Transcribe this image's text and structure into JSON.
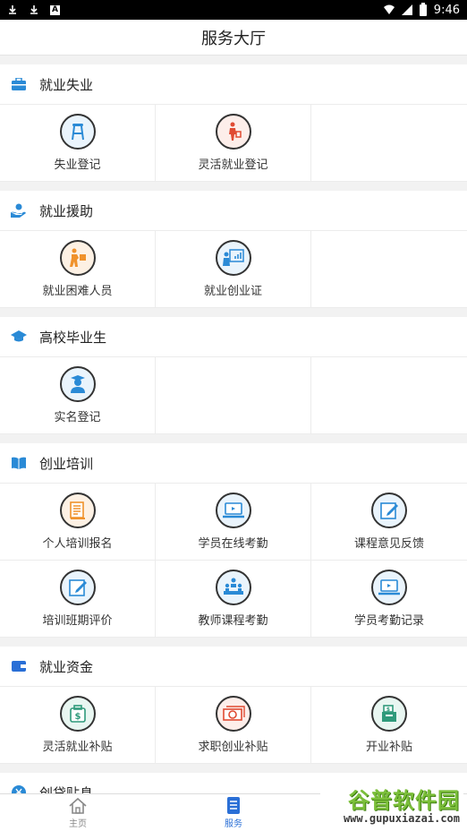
{
  "status": {
    "time": "9:46",
    "icons": [
      "download-icon",
      "download-icon",
      "a-icon"
    ]
  },
  "header": {
    "title": "服务大厅"
  },
  "sections": [
    {
      "title": "就业失业",
      "icon": "briefcase-icon",
      "items": [
        {
          "label": "失业登记",
          "icon": "stool-icon",
          "color": "blue"
        },
        {
          "label": "灵活就业登记",
          "icon": "worker-icon",
          "color": "red"
        }
      ]
    },
    {
      "title": "就业援助",
      "icon": "helping-hand-icon",
      "items": [
        {
          "label": "就业困难人员",
          "icon": "person-carry-icon",
          "color": "orange"
        },
        {
          "label": "就业创业证",
          "icon": "presentation-icon",
          "color": "blue"
        }
      ]
    },
    {
      "title": "高校毕业生",
      "icon": "graduation-cap-icon",
      "items": [
        {
          "label": "实名登记",
          "icon": "graduate-icon",
          "color": "blue"
        }
      ]
    },
    {
      "title": "创业培训",
      "icon": "open-book-icon",
      "items": [
        {
          "label": "个人培训报名",
          "icon": "document-icon",
          "color": "orange"
        },
        {
          "label": "学员在线考勤",
          "icon": "laptop-icon",
          "color": "blue"
        },
        {
          "label": "课程意见反馈",
          "icon": "edit-icon",
          "color": "blue"
        },
        {
          "label": "培训班期评价",
          "icon": "edit-icon",
          "color": "blue"
        },
        {
          "label": "教师课程考勤",
          "icon": "meeting-icon",
          "color": "blue"
        },
        {
          "label": "学员考勤记录",
          "icon": "laptop-icon",
          "color": "blue"
        }
      ]
    },
    {
      "title": "就业资金",
      "icon": "wallet-icon",
      "items": [
        {
          "label": "灵活就业补贴",
          "icon": "money-bag-icon",
          "color": "green"
        },
        {
          "label": "求职创业补贴",
          "icon": "cash-icon",
          "color": "red"
        },
        {
          "label": "开业补贴",
          "icon": "cash-register-icon",
          "color": "green"
        }
      ]
    },
    {
      "title": "创贷贴息",
      "icon": "yen-icon",
      "items": []
    }
  ],
  "tabbar": {
    "tabs": [
      {
        "label": "主页",
        "icon": "home-icon",
        "active": false
      },
      {
        "label": "服务",
        "icon": "list-icon",
        "active": true
      },
      {
        "label": "",
        "icon": "",
        "active": false
      }
    ]
  },
  "watermark": {
    "main": "谷普软件园",
    "url": "www.gupuxiazai.com"
  },
  "colors": {
    "blue": "#2a8ad6",
    "red": "#e04b33",
    "orange": "#f0922b",
    "green": "#2f9a7b",
    "active_tab": "#2a6fd6"
  }
}
